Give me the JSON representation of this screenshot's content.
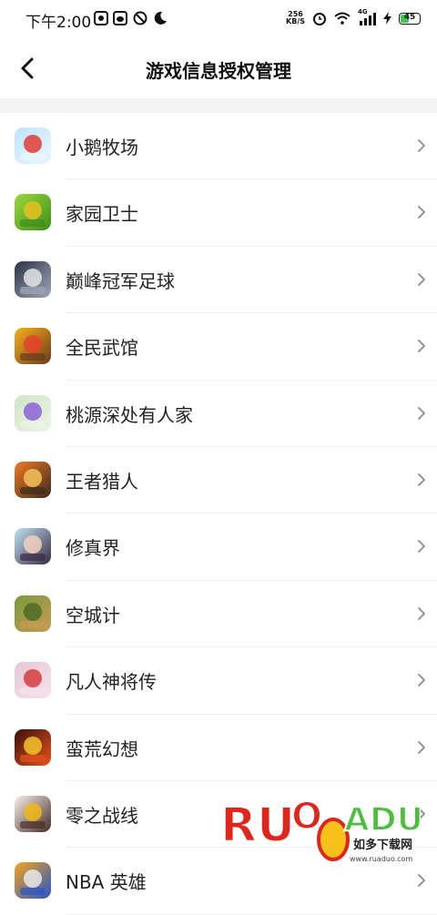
{
  "status_bar": {
    "time": "下午2:00",
    "net_speed_value": "256",
    "net_speed_unit": "KB/S",
    "signal_label": "4G",
    "battery_level": "45",
    "battery_color": "#3cc84c"
  },
  "header": {
    "title": "游戏信息授权管理",
    "back_icon": "chevron-left-icon"
  },
  "games": [
    {
      "label": "小鹅牧场",
      "icon": "goose-ranch-game-icon"
    },
    {
      "label": "家园卫士",
      "icon": "home-guardian-game-icon"
    },
    {
      "label": "巅峰冠军足球",
      "icon": "football-game-icon"
    },
    {
      "label": "全民武馆",
      "icon": "martial-hall-game-icon"
    },
    {
      "label": "桃源深处有人家",
      "icon": "peach-garden-game-icon"
    },
    {
      "label": "王者猎人",
      "icon": "king-hunter-game-icon"
    },
    {
      "label": "修真界",
      "icon": "cultivation-game-icon"
    },
    {
      "label": "空城计",
      "icon": "empty-city-game-icon"
    },
    {
      "label": "凡人神将传",
      "icon": "mortal-general-game-icon"
    },
    {
      "label": "蛮荒幻想",
      "icon": "wild-fantasy-game-icon"
    },
    {
      "label": "零之战线",
      "icon": "zero-front-game-icon"
    },
    {
      "label": "NBA 英雄",
      "icon": "nba-game-icon"
    }
  ],
  "watermark": {
    "brand": "RUOADUO",
    "tagline": "如多下载网",
    "url": "www.ruaduo.com"
  }
}
